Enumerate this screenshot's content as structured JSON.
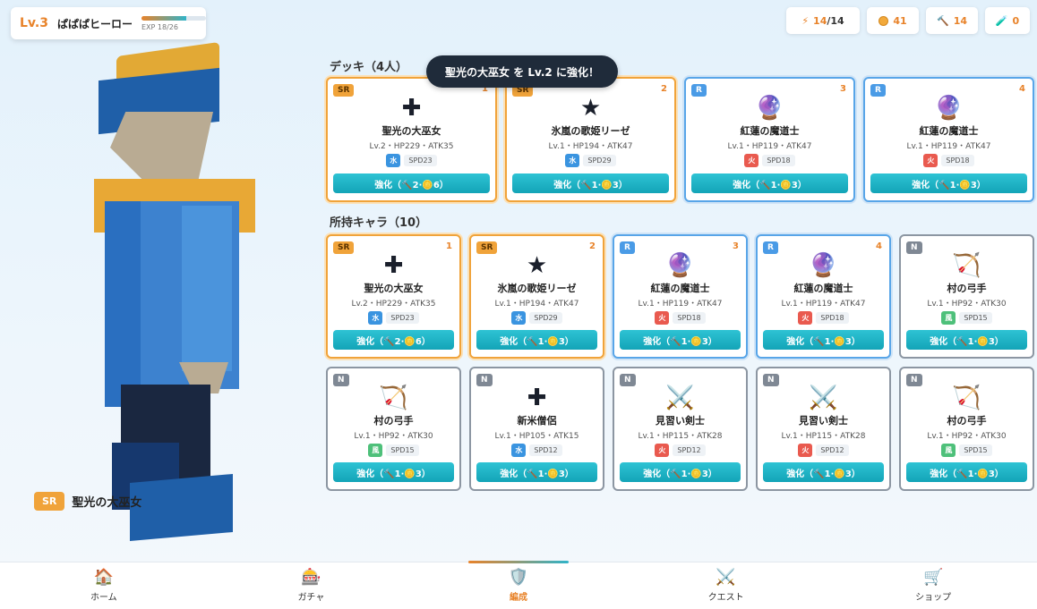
{
  "player": {
    "level": "Lv.3",
    "name": "ぱぱぱヒーロー",
    "exp_label": "EXP 18/26",
    "exp_fraction": 0.6923
  },
  "resources": {
    "energy": {
      "icon": "lightning-icon",
      "current": "14",
      "max": "/14"
    },
    "coins": {
      "icon": "coin-icon",
      "value": "41"
    },
    "hammers": {
      "icon": "hammer-icon",
      "value": "14"
    },
    "potions": {
      "icon": "potion-icon",
      "value": "0"
    }
  },
  "toast": "聖光の大巫女 を Lv.2 に強化！",
  "hero": {
    "rarity": "SR",
    "name": "聖光の大巫女"
  },
  "deck": {
    "title": "デッキ（4人）",
    "cards": [
      {
        "rarity": "SR",
        "slot": "1",
        "icon": "✚",
        "name": "聖光の大巫女",
        "stats": "Lv.2・HP229・ATK35",
        "element": "水",
        "element_type": "water",
        "spd": "SPD23",
        "button": "強化（🔨2·🪙6）"
      },
      {
        "rarity": "SR",
        "slot": "2",
        "icon": "★",
        "name": "氷嵐の歌姫リーゼ",
        "stats": "Lv.1・HP194・ATK47",
        "element": "水",
        "element_type": "water",
        "spd": "SPD29",
        "button": "強化（🔨1·🪙3）"
      },
      {
        "rarity": "R",
        "slot": "3",
        "icon": "🔮",
        "name": "紅蓮の魔道士",
        "stats": "Lv.1・HP119・ATK47",
        "element": "火",
        "element_type": "fire",
        "spd": "SPD18",
        "button": "強化（🔨1·🪙3）"
      },
      {
        "rarity": "R",
        "slot": "4",
        "icon": "🔮",
        "name": "紅蓮の魔道士",
        "stats": "Lv.1・HP119・ATK47",
        "element": "火",
        "element_type": "fire",
        "spd": "SPD18",
        "button": "強化（🔨1·🪙3）"
      }
    ]
  },
  "owned": {
    "title": "所持キャラ（10）",
    "cards": [
      {
        "rarity": "SR",
        "slot": "1",
        "icon": "✚",
        "name": "聖光の大巫女",
        "stats": "Lv.2・HP229・ATK35",
        "element": "水",
        "element_type": "water",
        "spd": "SPD23",
        "button": "強化（🔨2·🪙6）"
      },
      {
        "rarity": "SR",
        "slot": "2",
        "icon": "★",
        "name": "氷嵐の歌姫リーゼ",
        "stats": "Lv.1・HP194・ATK47",
        "element": "水",
        "element_type": "water",
        "spd": "SPD29",
        "button": "強化（🔨1·🪙3）"
      },
      {
        "rarity": "R",
        "slot": "3",
        "icon": "🔮",
        "name": "紅蓮の魔道士",
        "stats": "Lv.1・HP119・ATK47",
        "element": "火",
        "element_type": "fire",
        "spd": "SPD18",
        "button": "強化（🔨1·🪙3）"
      },
      {
        "rarity": "R",
        "slot": "4",
        "icon": "🔮",
        "name": "紅蓮の魔道士",
        "stats": "Lv.1・HP119・ATK47",
        "element": "火",
        "element_type": "fire",
        "spd": "SPD18",
        "button": "強化（🔨1·🪙3）"
      },
      {
        "rarity": "N",
        "slot": "",
        "icon": "🏹",
        "name": "村の弓手",
        "stats": "Lv.1・HP92・ATK30",
        "element": "風",
        "element_type": "wind",
        "spd": "SPD15",
        "button": "強化（🔨1·🪙3）"
      },
      {
        "rarity": "N",
        "slot": "",
        "icon": "🏹",
        "name": "村の弓手",
        "stats": "Lv.1・HP92・ATK30",
        "element": "風",
        "element_type": "wind",
        "spd": "SPD15",
        "button": "強化（🔨1·🪙3）"
      },
      {
        "rarity": "N",
        "slot": "",
        "icon": "✚",
        "name": "新米僧侶",
        "stats": "Lv.1・HP105・ATK15",
        "element": "水",
        "element_type": "water",
        "spd": "SPD12",
        "button": "強化（🔨1·🪙3）"
      },
      {
        "rarity": "N",
        "slot": "",
        "icon": "⚔️",
        "name": "見習い剣士",
        "stats": "Lv.1・HP115・ATK28",
        "element": "火",
        "element_type": "fire",
        "spd": "SPD12",
        "button": "強化（🔨1·🪙3）"
      },
      {
        "rarity": "N",
        "slot": "",
        "icon": "⚔️",
        "name": "見習い剣士",
        "stats": "Lv.1・HP115・ATK28",
        "element": "火",
        "element_type": "fire",
        "spd": "SPD12",
        "button": "強化（🔨1·🪙3）"
      },
      {
        "rarity": "N",
        "slot": "",
        "icon": "🏹",
        "name": "村の弓手",
        "stats": "Lv.1・HP92・ATK30",
        "element": "風",
        "element_type": "wind",
        "spd": "SPD15",
        "button": "強化（🔨1·🪙3）"
      }
    ]
  },
  "nav": [
    {
      "icon": "🏠",
      "icon_name": "home-icon",
      "label": "ホーム",
      "active": false
    },
    {
      "icon": "🎰",
      "icon_name": "gacha-icon",
      "label": "ガチャ",
      "active": false
    },
    {
      "icon": "🛡️",
      "icon_name": "shield-icon",
      "label": "編成",
      "active": true
    },
    {
      "icon": "⚔️",
      "icon_name": "crossed-swords-icon",
      "label": "クエスト",
      "active": false
    },
    {
      "icon": "🛒",
      "icon_name": "cart-icon",
      "label": "ショップ",
      "active": false
    }
  ],
  "colors": {
    "accent_orange": "#e8832a",
    "accent_teal": "#13a4b7",
    "sr": "#f0a33a",
    "r": "#4a9be6",
    "n": "#7f8894"
  }
}
